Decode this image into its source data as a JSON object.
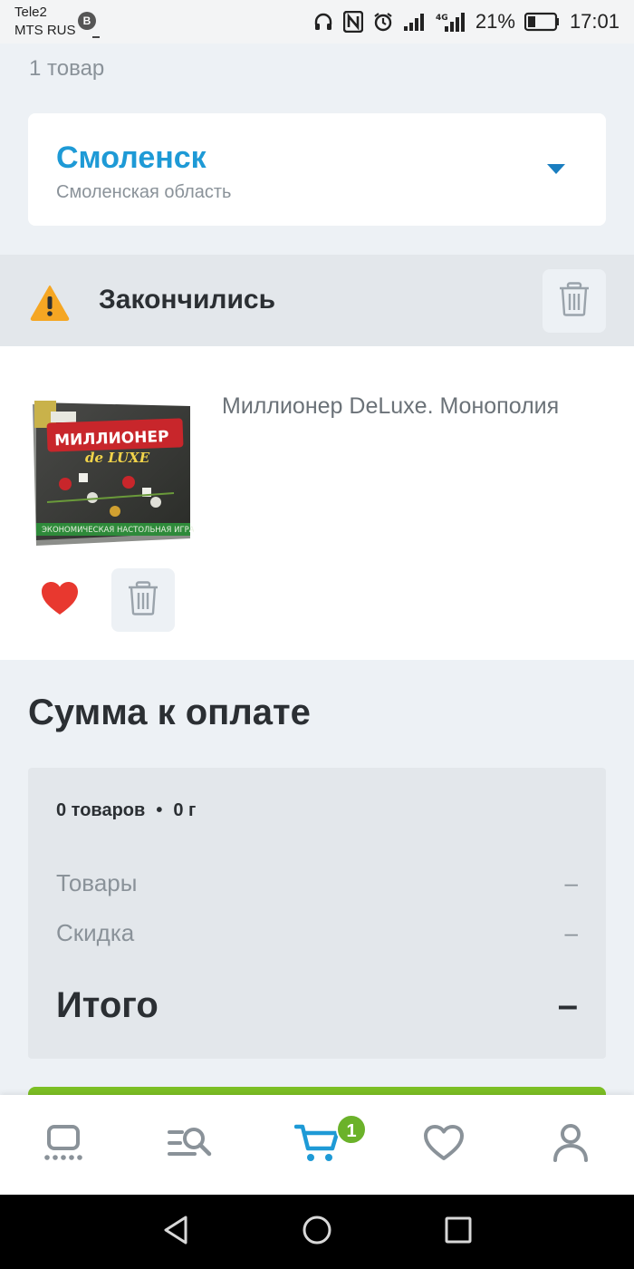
{
  "status_bar": {
    "carrier_1": "Tele2",
    "carrier_2": "MTS RUS",
    "badge": "B",
    "network": "4G",
    "battery": "21%",
    "time": "17:01"
  },
  "cart": {
    "item_count_label": "1 товар"
  },
  "city": {
    "name": "Смоленск",
    "region": "Смоленская область"
  },
  "out_of_stock": {
    "title": "Закончились"
  },
  "product": {
    "title": "Миллионер DeLuxe. Монополия",
    "image_text_main": "МИЛЛИОНЕР",
    "image_text_sub": "de LUXE",
    "image_text_bottom": "ЭКОНОМИЧЕСКАЯ НАСТОЛЬНАЯ ИГРА"
  },
  "summary": {
    "title": "Сумма к оплате",
    "goods_count": "0 товаров",
    "weight": "0 г",
    "rows": [
      {
        "label": "Товары",
        "value": "–"
      },
      {
        "label": "Скидка",
        "value": "–"
      }
    ],
    "total_label": "Итого",
    "total_value": "–"
  },
  "bottom_nav": {
    "cart_badge": "1",
    "items": [
      "home-icon",
      "catalog-search-icon",
      "cart-icon",
      "heart-icon",
      "profile-icon"
    ]
  },
  "colors": {
    "accent_blue": "#1e9ad6",
    "green": "#7cbf24",
    "warning": "#f5a623",
    "heart_red": "#e8382f"
  }
}
